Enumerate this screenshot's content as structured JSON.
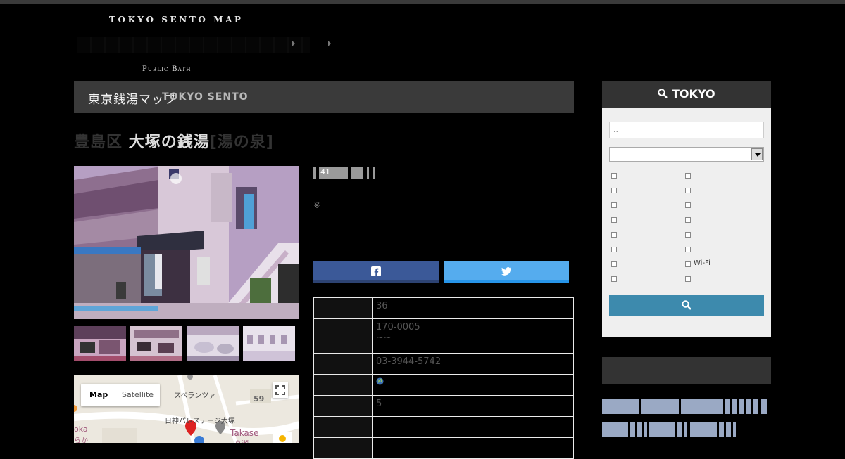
{
  "header": {
    "logo_text": "TOKYO SENTO MAP",
    "logo_subtitle": "Public Bath"
  },
  "nav": {
    "home_label": "東京銭湯マップ",
    "brand_label": "TOKYO SENTO"
  },
  "page": {
    "title_prefix": "豊島区",
    "title_main": "大塚の銭湯",
    "title_suffix": "[湯の泉]"
  },
  "badges": {
    "number": "41"
  },
  "note": "※",
  "share": {
    "facebook_icon": "facebook-icon",
    "twitter_icon": "twitter-icon"
  },
  "info_rows": [
    {
      "value": "36"
    },
    {
      "value": "170-0005",
      "value2": "~~"
    },
    {
      "value": "03-3944-5742"
    },
    {
      "value": "",
      "icon": "globe-icon"
    },
    {
      "value": "5"
    },
    {
      "value": ""
    },
    {
      "value": ""
    }
  ],
  "map": {
    "map_tab": "Map",
    "satellite_tab": "Satellite",
    "label_1": "スペランツァ",
    "label_2": "日神パレステージ大塚",
    "label_3": "Takase",
    "label_4": "高瀬",
    "label_5": "59",
    "label_6": "oka",
    "label_7": "らか"
  },
  "sidebar": {
    "search_title": "TOKYO",
    "search_placeholder": "..",
    "checkbox_wifi": "Wi-Fi"
  },
  "colors": {
    "facebook": "#3b5998",
    "twitter": "#55acee",
    "search_button": "#3d8aad",
    "tag": "#9aa9c4"
  }
}
